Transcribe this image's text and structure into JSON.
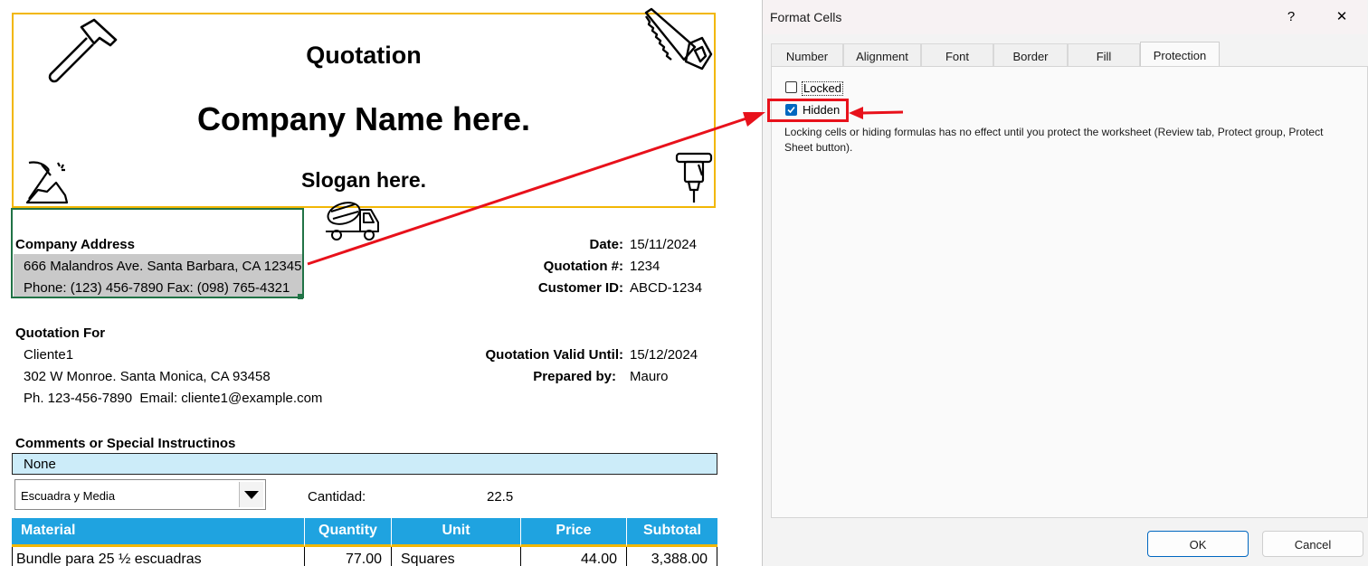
{
  "sheet": {
    "header": {
      "title": "Quotation",
      "company_name": "Company Name here.",
      "slogan": "Slogan here."
    },
    "company_address": {
      "label": "Company Address",
      "line1": "666 Malandros Ave. Santa Barbara, CA 12345",
      "line2": "Phone: (123) 456-7890 Fax: (098) 765-4321"
    },
    "meta": {
      "date_label": "Date:",
      "date_value": "15/11/2024",
      "quote_no_label": "Quotation #:",
      "quote_no_value": "1234",
      "customer_id_label": "Customer ID:",
      "customer_id_value": "ABCD-1234",
      "valid_until_label": "Quotation Valid Until:",
      "valid_until_value": "15/12/2024",
      "prepared_by_label": "Prepared by:",
      "prepared_by_value": "Mauro"
    },
    "quotation_for": {
      "label": "Quotation For",
      "name": "Cliente1",
      "address": "302 W Monroe. Santa Monica, CA 93458",
      "contact": "Ph. 123-456-7890  Email: cliente1@example.com"
    },
    "comments": {
      "label": "Comments or Special Instructinos",
      "value": "None"
    },
    "selector": {
      "selected": "Escuadra y Media",
      "qty_label": "Cantidad:",
      "qty_value": "22.5"
    },
    "table": {
      "headers": [
        "Material",
        "Quantity",
        "Unit",
        "Price",
        "Subtotal"
      ],
      "rows": [
        [
          "Bundle para 25 ½ escuadras",
          "77.00",
          "Squares",
          "44.00",
          "3,388.00"
        ]
      ]
    }
  },
  "dialog": {
    "title": "Format Cells",
    "help_glyph": "?",
    "close_glyph": "✕",
    "tabs": [
      "Number",
      "Alignment",
      "Font",
      "Border",
      "Fill",
      "Protection"
    ],
    "active_tab": "Protection",
    "locked_label": "Locked",
    "locked_checked": false,
    "hidden_label": "Hidden",
    "hidden_checked": true,
    "note": "Locking cells or hiding formulas has no effect until you protect the worksheet (Review tab, Protect group, Protect Sheet button).",
    "ok_label": "OK",
    "cancel_label": "Cancel"
  },
  "colors": {
    "header_border": "#f2b705",
    "table_header": "#1fa3e0",
    "comments_fill": "#ccecf9",
    "annotation_red": "#e8111b",
    "accent_blue": "#0067c0"
  },
  "icons": [
    "hammer-icon",
    "saw-icon",
    "pickaxe-icon",
    "jackhammer-icon",
    "cement-truck-icon",
    "dropdown-arrow-icon",
    "checkmark-icon",
    "help-icon",
    "close-icon"
  ]
}
